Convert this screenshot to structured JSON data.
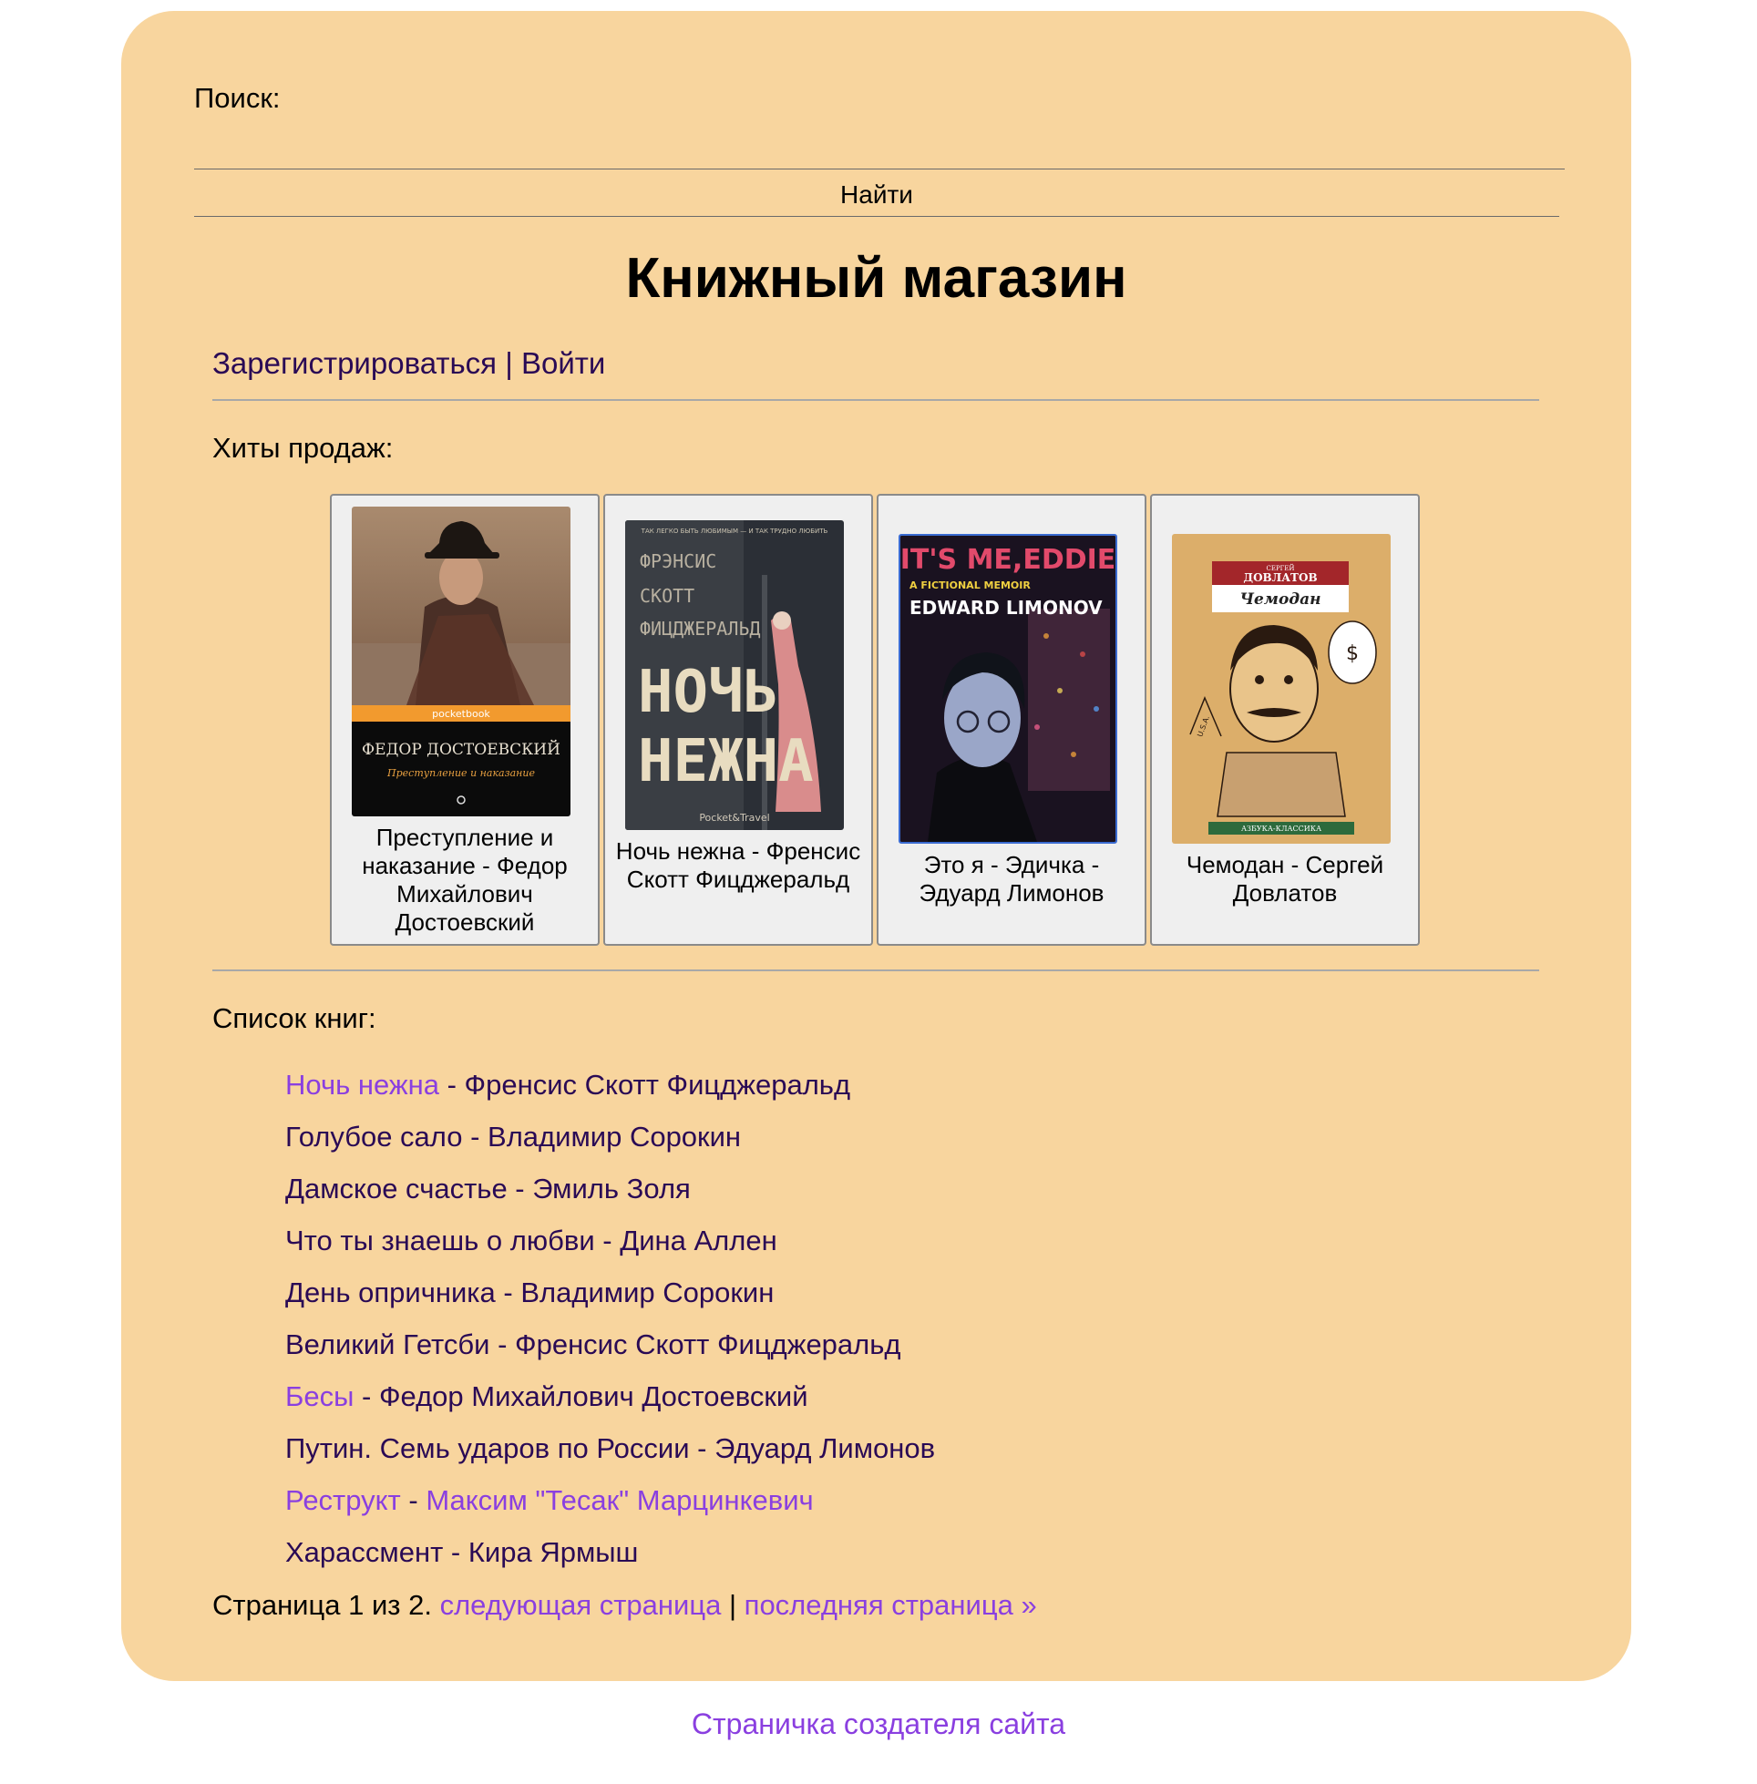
{
  "search": {
    "label": "Поиск:",
    "value": "",
    "placeholder": "",
    "button": "Найти"
  },
  "title": "Книжный магазин",
  "auth": {
    "register": "Зарегистрироваться",
    "separator": "|",
    "login": "Войти"
  },
  "bestsellers": {
    "label": "Хиты продаж:",
    "books": [
      {
        "caption": "Преступление и наказание - Федор Михайлович Достоевский",
        "cover": {
          "badge": "pocketbook",
          "author": "ФЕДОР ДОСТОЕВСКИЙ",
          "title": "Преступление и наказание"
        }
      },
      {
        "caption": "Ночь нежна - Френсис Скотт Фицджеральд",
        "cover": {
          "tagline": "ТАК ЛЕГКО БЫТЬ ЛЮБИМЫМ — И ТАК ТРУДНО ЛЮБИТЬ",
          "author_l1": "ФРЭНСИС",
          "author_l2": "СКОТТ",
          "author_l3": "ФИЦДЖЕРАЛЬД",
          "title_l1": "НОЧЬ",
          "title_l2": "НЕЖНА",
          "publisher": "Pocket&Travel"
        }
      },
      {
        "caption": "Это я - Эдичка - Эдуард Лимонов",
        "cover": {
          "title": "IT'S ME,EDDIE",
          "subtitle": "A FICTIONAL MEMOIR",
          "author": "EDWARD LIMONOV"
        }
      },
      {
        "caption": "Чемодан - Сергей Довлатов",
        "cover": {
          "author_first": "СЕРГЕЙ",
          "author_last": "ДОВЛАТОВ",
          "title": "Чемодан",
          "sign": "U.S.A.",
          "publisher": "АЗБУКА-КЛАССИКА"
        }
      }
    ]
  },
  "list": {
    "label": "Список книг:",
    "items": [
      {
        "title": "Ночь нежна",
        "author": "Френсис Скотт Фицджеральд"
      },
      {
        "title": "Голубое сало",
        "author": "Владимир Сорокин"
      },
      {
        "title": "Дамское счастье",
        "author": "Эмиль Золя"
      },
      {
        "title": "Что ты знаешь о любви",
        "author": "Дина Аллен"
      },
      {
        "title": "День опричника",
        "author": "Владимир Сорокин"
      },
      {
        "title": "Великий Гетсби",
        "author": "Френсис Скотт Фицджеральд"
      },
      {
        "title": "Бесы",
        "author": "Федор Михайлович Достоевский"
      },
      {
        "title": "Путин. Семь ударов по России",
        "author": "Эдуард Лимонов"
      },
      {
        "title": "Реструкт",
        "author": "Максим \"Тесак\" Марцинкевич"
      },
      {
        "title": "Харассмент",
        "author": "Кира Ярмыш"
      }
    ],
    "separator": " - "
  },
  "pagination": {
    "text": "Страница 1 из 2.",
    "next": "следующая страница",
    "separator": "|",
    "last": "последняя страница »"
  },
  "footer": {
    "link": "Страничка создателя сайта"
  },
  "colors": {
    "panel": "#f8d59e",
    "link": "#2a0a55",
    "visited": "#8a3fe0",
    "card": "#efefef"
  }
}
